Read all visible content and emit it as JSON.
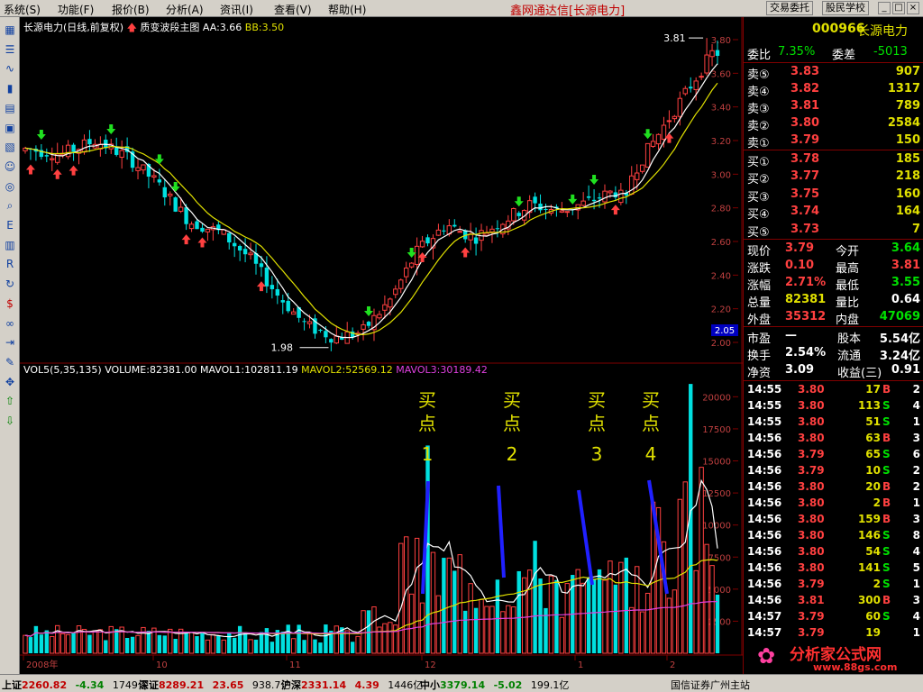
{
  "menu": [
    {
      "label": "系统(S)"
    },
    {
      "label": "功能(F)"
    },
    {
      "label": "报价(B)"
    },
    {
      "label": "分析(A)"
    },
    {
      "label": "资讯(I)"
    },
    {
      "label": "查看(V)"
    },
    {
      "label": "帮助(H)"
    }
  ],
  "app_title": "鑫网通达信[长源电力]",
  "top_buttons": {
    "trade": "交易委托",
    "school": "股民学校"
  },
  "window_buttons": [
    "_",
    "□",
    "×"
  ],
  "toolbar_icons": [
    "grid-icon",
    "list-icon",
    "line-chart-icon",
    "candle-icon",
    "table-icon",
    "report-icon",
    "news-icon",
    "people-icon",
    "globe-icon",
    "search-icon",
    "etf-icon",
    "bar-chart-icon",
    "rsi-icon",
    "refresh-icon",
    "dollar-icon",
    "link-icon",
    "export-icon",
    "pencil-icon",
    "move-icon",
    "up-arrow-icon",
    "down-arrow-icon"
  ],
  "main_chart": {
    "legend": {
      "title": "长源电力(日线,前复权)",
      "indicator": "质变波段主图",
      "aa": "AA:3.66",
      "bb": "BB:3.50"
    },
    "price_labels": [
      "3.80",
      "3.60",
      "3.40",
      "3.20",
      "3.00",
      "2.80",
      "2.60",
      "2.40",
      "2.20",
      "2.00"
    ],
    "high_marker": "3.81",
    "low_marker": "1.98",
    "cursor_price": "2.05",
    "colors": {
      "up": "#ff4040",
      "down": "#00e0e0",
      "ma_fast": "#ffffff",
      "ma_slow": "#e0e000"
    }
  },
  "volume_chart": {
    "legend": {
      "name": "VOL5(5,35,135)",
      "volume": "VOLUME:82381.00",
      "mavol1": "MAVOL1:102811.19",
      "mavol2": "MAVOL2:52569.12",
      "mavol3": "MAVOL3:30189.42"
    },
    "vol_labels": [
      "20000",
      "17500",
      "15000",
      "12500",
      "10000",
      "7500",
      "5000",
      "2500"
    ],
    "annotations": [
      {
        "text1": "买",
        "text2": "点",
        "num": "1"
      },
      {
        "text1": "买",
        "text2": "点",
        "num": "2"
      },
      {
        "text1": "买",
        "text2": "点",
        "num": "3"
      },
      {
        "text1": "买",
        "text2": "点",
        "num": "4"
      }
    ],
    "date_labels": [
      "2008年",
      "10",
      "11",
      "12",
      "1",
      "2"
    ]
  },
  "chart_data": {
    "type": "bar",
    "title": "长源电力(日线,前复权)",
    "price_range": [
      1.95,
      3.85
    ],
    "volume_range": [
      0,
      21000
    ],
    "price_ticks": [
      2.0,
      2.2,
      2.4,
      2.6,
      2.8,
      3.0,
      3.2,
      3.4,
      3.6,
      3.8
    ],
    "volume_ticks": [
      2500,
      5000,
      7500,
      10000,
      12500,
      15000,
      17500,
      20000
    ],
    "high": 3.81,
    "low": 1.98,
    "series": [
      {
        "name": "VOLUME",
        "value": 82381.0
      },
      {
        "name": "MAVOL1",
        "value": 102811.19
      },
      {
        "name": "MAVOL2",
        "value": 52569.12
      },
      {
        "name": "MAVOL3",
        "value": 30189.42
      }
    ]
  },
  "quote": {
    "code": "000966",
    "name": "长源电力",
    "weibi_label": "委比",
    "weibi": "7.35%",
    "weicha_label": "委差",
    "weicha": "-5013",
    "asks": [
      {
        "label": "卖⑤",
        "price": "3.83",
        "vol": "907"
      },
      {
        "label": "卖④",
        "price": "3.82",
        "vol": "1317"
      },
      {
        "label": "卖③",
        "price": "3.81",
        "vol": "789"
      },
      {
        "label": "卖②",
        "price": "3.80",
        "vol": "2584"
      },
      {
        "label": "卖①",
        "price": "3.79",
        "vol": "150"
      }
    ],
    "bids": [
      {
        "label": "买①",
        "price": "3.78",
        "vol": "185"
      },
      {
        "label": "买②",
        "price": "3.77",
        "vol": "218"
      },
      {
        "label": "买③",
        "price": "3.75",
        "vol": "160"
      },
      {
        "label": "买④",
        "price": "3.74",
        "vol": "164"
      },
      {
        "label": "买⑤",
        "price": "3.73",
        "vol": "7"
      }
    ],
    "stats": [
      {
        "l1": "现价",
        "v1": "3.79",
        "l2": "今开",
        "v2": "3.64"
      },
      {
        "l1": "涨跌",
        "v1": "0.10",
        "l2": "最高",
        "v2": "3.81"
      },
      {
        "l1": "涨幅",
        "v1": "2.71%",
        "l2": "最低",
        "v2": "3.55"
      },
      {
        "l1": "总量",
        "v1": "82381",
        "l2": "量比",
        "v2": "0.64"
      },
      {
        "l1": "外盘",
        "v1": "35312",
        "l2": "内盘",
        "v2": "47069"
      }
    ],
    "fundamentals": [
      {
        "l1": "市盈",
        "v1": "—",
        "l2": "股本",
        "v2": "5.54亿"
      },
      {
        "l1": "换手",
        "v1": "2.54%",
        "l2": "流通",
        "v2": "3.24亿"
      },
      {
        "l1": "净资",
        "v1": "3.09",
        "l2": "收益(三)",
        "v2": "0.91"
      }
    ]
  },
  "ticks": [
    {
      "time": "14:55",
      "price": "3.80",
      "vol": "17",
      "side": "B",
      "n": "2"
    },
    {
      "time": "14:55",
      "price": "3.80",
      "vol": "113",
      "side": "S",
      "n": "4"
    },
    {
      "time": "14:55",
      "price": "3.80",
      "vol": "51",
      "side": "S",
      "n": "1"
    },
    {
      "time": "14:56",
      "price": "3.80",
      "vol": "63",
      "side": "B",
      "n": "3"
    },
    {
      "time": "14:56",
      "price": "3.79",
      "vol": "65",
      "side": "S",
      "n": "6"
    },
    {
      "time": "14:56",
      "price": "3.79",
      "vol": "10",
      "side": "S",
      "n": "2"
    },
    {
      "time": "14:56",
      "price": "3.80",
      "vol": "20",
      "side": "B",
      "n": "2"
    },
    {
      "time": "14:56",
      "price": "3.80",
      "vol": "2",
      "side": "B",
      "n": "1"
    },
    {
      "time": "14:56",
      "price": "3.80",
      "vol": "159",
      "side": "B",
      "n": "3"
    },
    {
      "time": "14:56",
      "price": "3.80",
      "vol": "146",
      "side": "S",
      "n": "8"
    },
    {
      "time": "14:56",
      "price": "3.80",
      "vol": "54",
      "side": "S",
      "n": "4"
    },
    {
      "time": "14:56",
      "price": "3.80",
      "vol": "141",
      "side": "S",
      "n": "5"
    },
    {
      "time": "14:56",
      "price": "3.79",
      "vol": "2",
      "side": "S",
      "n": "1"
    },
    {
      "time": "14:56",
      "price": "3.81",
      "vol": "300",
      "side": "B",
      "n": "3"
    },
    {
      "time": "14:57",
      "price": "3.79",
      "vol": "60",
      "side": "S",
      "n": "4"
    },
    {
      "time": "14:57",
      "price": "3.79",
      "vol": "19",
      "side": "",
      "n": "1"
    }
  ],
  "status": {
    "sh": {
      "name": "上证",
      "value": "2260.82",
      "chg": "-4.34",
      "amt": "1749亿"
    },
    "sz": {
      "name": "深证",
      "value": "8289.21",
      "chg": "23.65",
      "amt": "938.7亿"
    },
    "hs": {
      "name": "沪深",
      "value": "2331.14",
      "chg": "4.39",
      "amt": "1446亿"
    },
    "zx": {
      "name": "中小",
      "value": "3379.14",
      "chg": "-5.02",
      "amt": "199.1亿"
    },
    "broker": "国信证券广州主站"
  },
  "watermark": {
    "text": "分析家公式网",
    "url": "www.88gs.com"
  }
}
